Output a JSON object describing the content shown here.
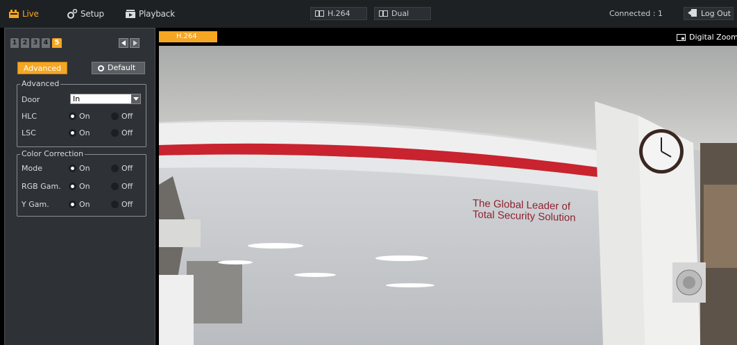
{
  "topbar": {
    "nav": [
      {
        "label": "Live",
        "icon": "live-icon",
        "active": true
      },
      {
        "label": "Setup",
        "icon": "setup-gear-icon",
        "active": false
      },
      {
        "label": "Playback",
        "icon": "playback-icon",
        "active": false
      }
    ],
    "streams": [
      {
        "label": "H.264",
        "icon": "monitor-icon"
      },
      {
        "label": "Dual",
        "icon": "monitor-icon"
      }
    ],
    "connected": "Connected : 1",
    "logout": "Log Out"
  },
  "panel": {
    "channel_tabs": [
      "1",
      "2",
      "3",
      "4",
      "5"
    ],
    "active_tab": "5",
    "buttons": {
      "advanced": "Advanced",
      "default": "Default"
    },
    "advanced_group": {
      "title": "Advanced",
      "door": {
        "label": "Door",
        "value": "In"
      },
      "hlc": {
        "label": "HLC",
        "on": "On",
        "off": "Off",
        "selected": "On"
      },
      "lsc": {
        "label": "LSC",
        "on": "On",
        "off": "Off",
        "selected": "On"
      }
    },
    "color_group": {
      "title": "Color Correction",
      "mode": {
        "label": "Mode",
        "on": "On",
        "off": "Off",
        "selected": "On"
      },
      "rgb_gam": {
        "label": "RGB Gam.",
        "on": "On",
        "off": "Off",
        "selected": "On"
      },
      "y_gam": {
        "label": "Y Gam.",
        "on": "On",
        "off": "Off",
        "selected": "On"
      }
    }
  },
  "video": {
    "tab_label": "H.264",
    "digital_zoom": "Digital Zoom",
    "wall_text_line1": "The Global Leader of",
    "wall_text_line2": "Total Security Solution"
  },
  "colors": {
    "accent": "#f5a623",
    "topbar": "#1e2124",
    "panel": "#2e3236",
    "stripe": "#c8232f"
  }
}
